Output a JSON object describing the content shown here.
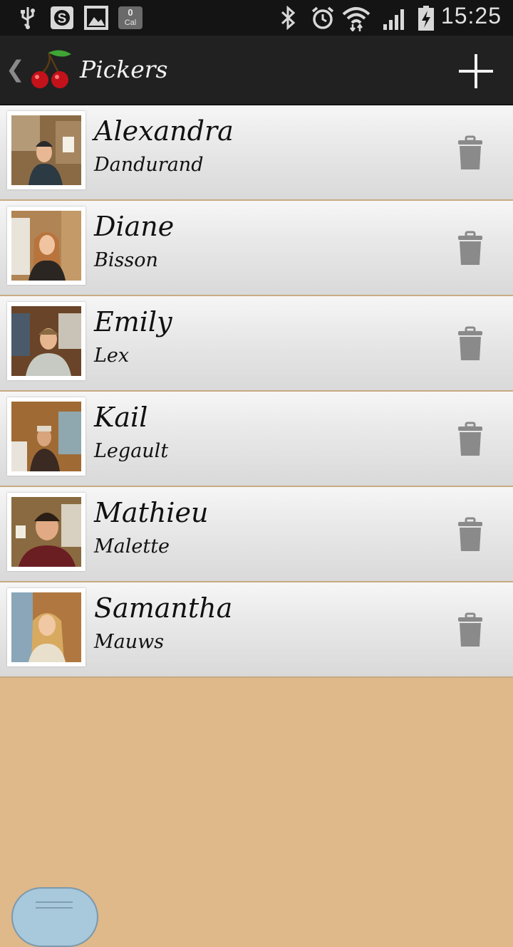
{
  "status_bar": {
    "time": "15:25",
    "calorie_badge": {
      "count": "0",
      "label": "Cal"
    },
    "icons": [
      "usb-icon",
      "s-app-icon",
      "gallery-icon",
      "calorie-icon",
      "bluetooth-icon",
      "alarm-icon",
      "wifi-icon",
      "signal-icon",
      "battery-icon"
    ]
  },
  "action_bar": {
    "title": "Pickers",
    "icons": [
      "back-chevron-icon",
      "cherry-logo-icon",
      "add-icon"
    ]
  },
  "pickers": [
    {
      "first_name": "Alexandra",
      "last_name": "Dandurand"
    },
    {
      "first_name": "Diane",
      "last_name": "Bisson"
    },
    {
      "first_name": "Emily",
      "last_name": "Lex"
    },
    {
      "first_name": "Kail",
      "last_name": "Legault"
    },
    {
      "first_name": "Mathieu",
      "last_name": "Malette"
    },
    {
      "first_name": "Samantha",
      "last_name": "Mauws"
    }
  ],
  "colors": {
    "background": "#dfb98a",
    "action_bar": "#212121",
    "status_bar": "#141414",
    "divider": "#c7ab82",
    "trash_icon": "#8a8a8a"
  }
}
